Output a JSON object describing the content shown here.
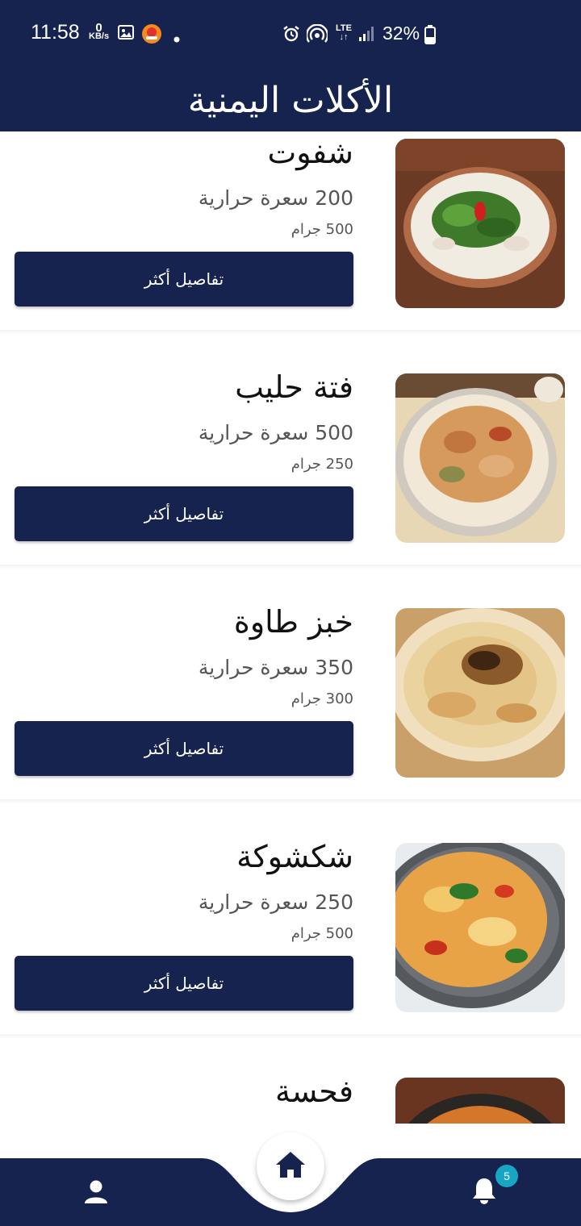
{
  "status_bar": {
    "time": "11:58",
    "kbs_value": "0",
    "kbs_unit": "KB/s",
    "network": "LTE",
    "battery": "32%",
    "icons": [
      "gallery-icon",
      "app-notification-icon",
      "alarm-icon",
      "hotspot-icon",
      "signal-icon",
      "battery-icon"
    ]
  },
  "app_bar": {
    "title": "الأكلات اليمنية"
  },
  "foods": [
    {
      "name": "شفوت",
      "calories": "200 سعرة حرارية",
      "weight": "500 جرام",
      "button": "تفاصيل أكثر"
    },
    {
      "name": "فتة حليب",
      "calories": "500 سعرة حرارية",
      "weight": "250 جرام",
      "button": "تفاصيل أكثر"
    },
    {
      "name": "خبز طاوة",
      "calories": "350 سعرة حرارية",
      "weight": "300 جرام",
      "button": "تفاصيل أكثر"
    },
    {
      "name": "شكشوكة",
      "calories": "250 سعرة حرارية",
      "weight": "500 جرام",
      "button": "تفاصيل أكثر"
    },
    {
      "name": "فحسة"
    }
  ],
  "bottom_nav": {
    "notification_count": "5",
    "items": [
      "profile-icon",
      "home-icon",
      "notification-bell-icon"
    ]
  },
  "colors": {
    "primary": "#17234f",
    "badge": "#17a7c4"
  }
}
